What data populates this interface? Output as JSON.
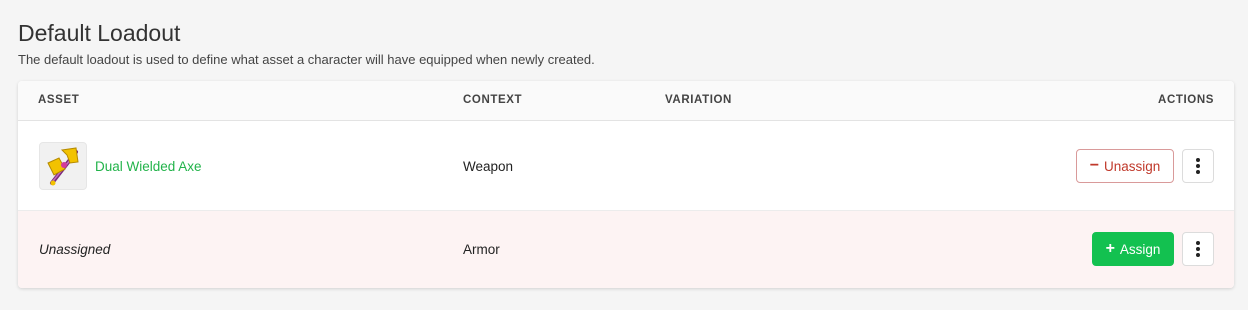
{
  "page": {
    "title": "Default Loadout",
    "subtitle": "The default loadout is used to define what asset a character will have equipped when newly created."
  },
  "table": {
    "columns": {
      "asset": "ASSET",
      "context": "CONTEXT",
      "variation": "VARIATION",
      "actions": "ACTIONS"
    },
    "rows": [
      {
        "asset": "Dual Wielded Axe",
        "asset_icon": "axe-icon",
        "context": "Weapon",
        "variation": "",
        "action_label": "Unassign",
        "action_icon": "minus-icon"
      },
      {
        "asset": "Unassigned",
        "context": "Armor",
        "variation": "",
        "action_label": "Assign",
        "action_icon": "plus-icon"
      }
    ]
  },
  "colors": {
    "link_green": "#22b34a",
    "assign_green": "#13c150",
    "unassign_red": "#c0392b",
    "unassigned_row_bg": "#fdf3f3"
  }
}
